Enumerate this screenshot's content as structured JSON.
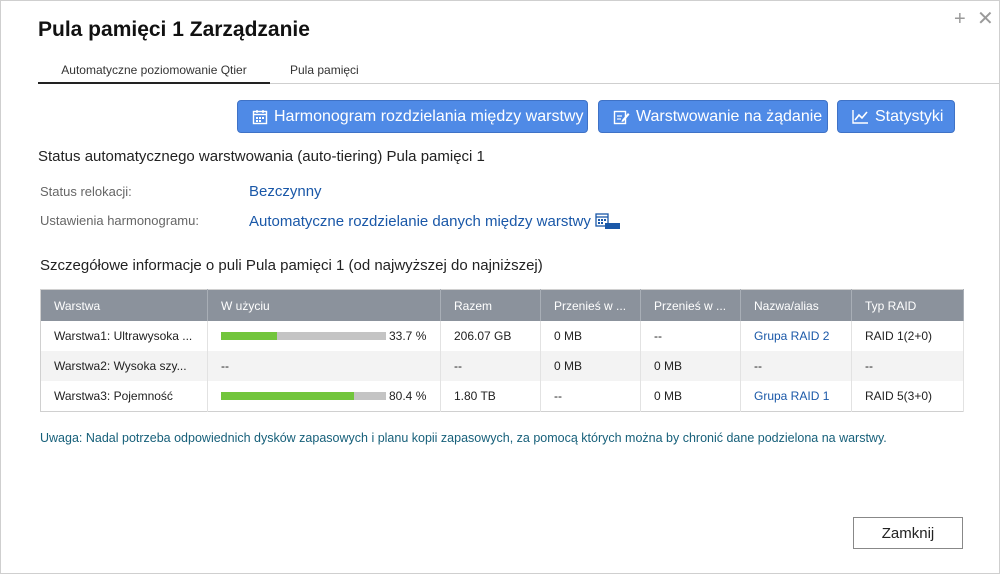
{
  "dialog": {
    "title": "Pula pamięci 1 Zarządzanie",
    "controls": {
      "maximize": "+",
      "close": "✕"
    }
  },
  "tabs": [
    {
      "label": "Automatyczne poziomowanie Qtier",
      "active": true
    },
    {
      "label": "Pula pamięci",
      "active": false
    }
  ],
  "toolbar": {
    "schedule_label": "Harmonogram rozdzielania między warstwy",
    "on_demand_label": "Warstwowanie na żądanie",
    "stats_label": "Statystyki",
    "schedule_icon": "calendar-icon",
    "on_demand_icon": "edit-icon",
    "stats_icon": "line-chart-icon"
  },
  "status": {
    "heading": "Status automatycznego warstwowania (auto-tiering) Pula pamięci 1",
    "relocation_label": "Status relokacji:",
    "relocation_value": "Bezczynny",
    "schedule_label": "Ustawienia harmonogramu:",
    "schedule_value": "Automatyczne rozdzielanie danych między warstwy",
    "schedule_icon": "calendar-auto-icon"
  },
  "details": {
    "heading": "Szczegółowe informacje o puli Pula pamięci 1 (od najwyższej do najniższej)",
    "columns": [
      "Warstwa",
      "W użyciu",
      "Razem",
      "Przenieś w ...",
      "Przenieś w ...",
      "Nazwa/alias",
      "Typ RAID"
    ],
    "rows": [
      {
        "tier": "Warstwa1: Ultrawysoka ...",
        "usage_pct": 33.7,
        "usage_text": "33.7 %",
        "total": "206.07 GB",
        "move_up": "0 MB",
        "move_down": "--",
        "alias": "Grupa RAID 2",
        "raid": "RAID 1(2+0)"
      },
      {
        "tier": "Warstwa2: Wysoka szy...",
        "usage_pct": null,
        "usage_text": "--",
        "total": "--",
        "move_up": "0 MB",
        "move_down": "0 MB",
        "alias": "--",
        "raid": "--"
      },
      {
        "tier": "Warstwa3: Pojemność",
        "usage_pct": 80.4,
        "usage_text": "80.4 %",
        "total": "1.80 TB",
        "move_up": "--",
        "move_down": "0 MB",
        "alias": "Grupa RAID 1",
        "raid": "RAID 5(3+0)"
      }
    ]
  },
  "note": "Uwaga: Nadal potrzeba odpowiednich dysków zapasowych i planu kopii zapasowych, za pomocą których można by chronić dane podzielona na warstwy.",
  "footer": {
    "close_label": "Zamknij"
  },
  "colors": {
    "accent": "#4f8ae6",
    "link": "#1a58a8",
    "bar_fill": "#72c53c",
    "bar_track": "#c4c4c4",
    "header_bg": "#8b929c",
    "note": "#17607a"
  }
}
